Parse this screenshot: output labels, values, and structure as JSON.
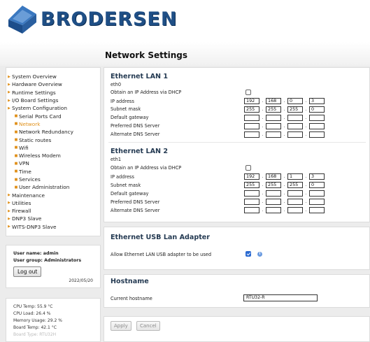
{
  "brand": {
    "name": "BRODERSEN"
  },
  "page": {
    "title": "Network Settings"
  },
  "sidebar": {
    "items": [
      {
        "label": "System Overview",
        "level": 0,
        "active": false
      },
      {
        "label": "Hardware Overview",
        "level": 0,
        "active": false
      },
      {
        "label": "Runtime Settings",
        "level": 0,
        "active": false
      },
      {
        "label": "I/O Board Settings",
        "level": 0,
        "active": false
      },
      {
        "label": "System Configuration",
        "level": 0,
        "active": false
      },
      {
        "label": "Serial Ports Card",
        "level": 1,
        "active": false
      },
      {
        "label": "Network",
        "level": 1,
        "active": true
      },
      {
        "label": "Network Redundancy",
        "level": 1,
        "active": false
      },
      {
        "label": "Static routes",
        "level": 1,
        "active": false
      },
      {
        "label": "Wifi",
        "level": 1,
        "active": false
      },
      {
        "label": "Wireless Modem",
        "level": 1,
        "active": false
      },
      {
        "label": "VPN",
        "level": 1,
        "active": false
      },
      {
        "label": "Time",
        "level": 1,
        "active": false
      },
      {
        "label": "Services",
        "level": 1,
        "active": false
      },
      {
        "label": "User Administration",
        "level": 1,
        "active": false
      },
      {
        "label": "Maintenance",
        "level": 0,
        "active": false
      },
      {
        "label": "Utilities",
        "level": 0,
        "active": false
      },
      {
        "label": "Firewall",
        "level": 0,
        "active": false
      },
      {
        "label": "DNP3 Slave",
        "level": 0,
        "active": false
      },
      {
        "label": "WITS-DNP3 Slave",
        "level": 0,
        "active": false
      }
    ]
  },
  "user": {
    "name_line": "User name: admin",
    "group_line": "User group: Administrators",
    "logout_label": "Log out",
    "date": "2022/05/20"
  },
  "stats": [
    "CPU Temp: 55.9 °C",
    "CPU Load: 26.4 %",
    "Memory Usage: 29.2 %",
    "Board Temp: 42.1 °C",
    "Board Type: RTU32H"
  ],
  "labels": {
    "dhcp": "Obtain an IP Address via DHCP",
    "ip": "IP address",
    "mask": "Subnet mask",
    "gateway": "Default gateway",
    "dns1": "Preferred DNS Server",
    "dns2": "Alternate DNS Server"
  },
  "lan1": {
    "title": "Ethernet LAN 1",
    "iface": "eth0",
    "dhcp": false,
    "ip": [
      "192",
      "168",
      "0",
      "3"
    ],
    "mask": [
      "255",
      "255",
      "255",
      "0"
    ],
    "gateway": [
      "",
      "",
      "",
      ""
    ],
    "dns1": [
      "",
      "",
      "",
      ""
    ],
    "dns2": [
      "",
      "",
      "",
      ""
    ]
  },
  "lan2": {
    "title": "Ethernet LAN 2",
    "iface": "eth1",
    "dhcp": false,
    "ip": [
      "192",
      "168",
      "1",
      "3"
    ],
    "mask": [
      "255",
      "255",
      "255",
      "0"
    ],
    "gateway": [
      "",
      "",
      "",
      ""
    ],
    "dns1": [
      "",
      "",
      "",
      ""
    ],
    "dns2": [
      "",
      "",
      "",
      ""
    ]
  },
  "usb": {
    "title": "Ethernet USB Lan Adapter",
    "label": "Allow Ethernet LAN USB adapter to be used",
    "checked": true,
    "info_icon": "info-icon"
  },
  "hostname": {
    "title": "Hostname",
    "label": "Current hostname",
    "value": "RTU32-R"
  },
  "actions": {
    "apply": "Apply",
    "cancel": "Cancel"
  }
}
